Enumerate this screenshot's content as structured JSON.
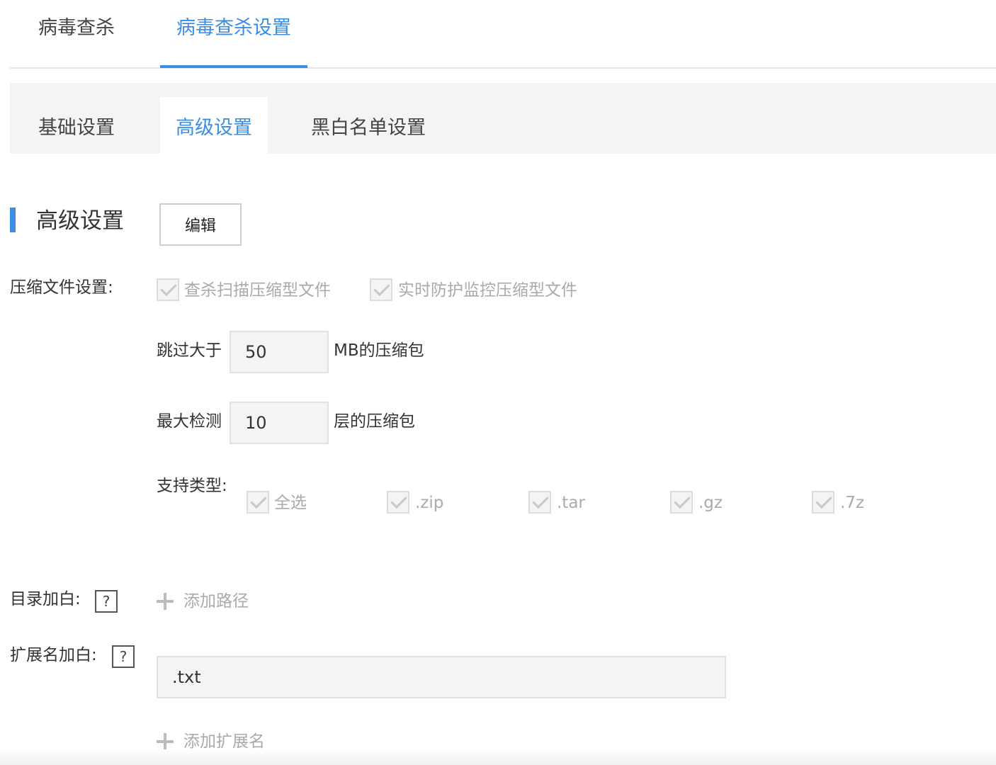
{
  "top_tabs": [
    {
      "label": "病毒查杀",
      "active": false
    },
    {
      "label": "病毒查杀设置",
      "active": true
    }
  ],
  "sub_tabs": [
    {
      "label": "基础设置",
      "active": false
    },
    {
      "label": "高级设置",
      "active": true
    },
    {
      "label": "黑白名单设置",
      "active": false
    }
  ],
  "section": {
    "title": "高级设置",
    "edit_label": "编辑"
  },
  "compress": {
    "label": "压缩文件设置:",
    "scan_option": {
      "label": "查杀扫描压缩型文件",
      "checked": true
    },
    "realtime_option": {
      "label": "实时防护监控压缩型文件",
      "checked": true
    },
    "skip_prefix": "跳过大于",
    "skip_value": "50",
    "skip_suffix": "MB的压缩包",
    "depth_prefix": "最大检测",
    "depth_value": "10",
    "depth_suffix": "层的压缩包",
    "types_label": "支持类型:",
    "types": [
      {
        "label": "全选",
        "checked": true
      },
      {
        "label": ".zip",
        "checked": true
      },
      {
        "label": ".tar",
        "checked": true
      },
      {
        "label": ".gz",
        "checked": true
      },
      {
        "label": ".7z",
        "checked": true
      }
    ]
  },
  "dir_whitelist": {
    "label": "目录加白:",
    "help": "?",
    "add_label": "添加路径"
  },
  "ext_whitelist": {
    "label": "扩展名加白:",
    "help": "?",
    "value": ".txt",
    "add_label": "添加扩展名"
  },
  "colors": {
    "accent": "#3a8ee6",
    "tab_bg": "#f4f4f4",
    "disabled": "#aaaaaa"
  }
}
